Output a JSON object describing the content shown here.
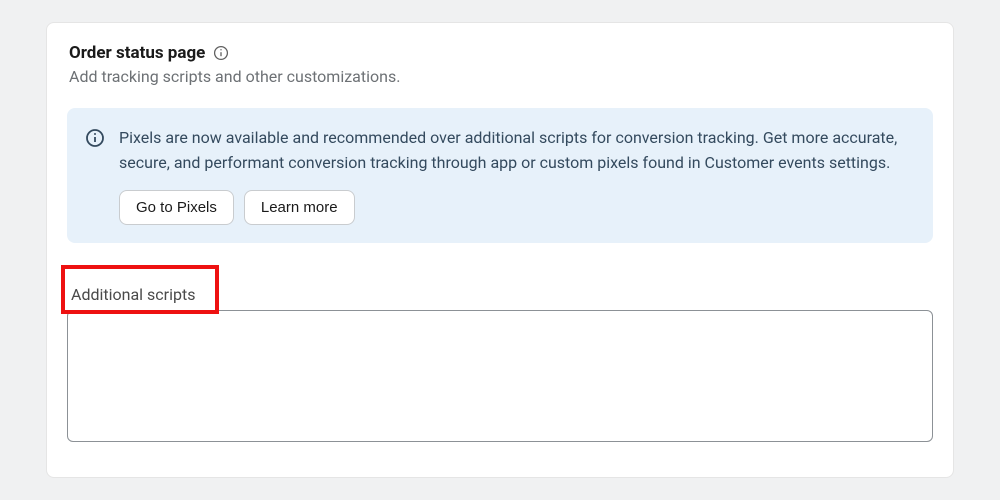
{
  "header": {
    "title": "Order status page",
    "subtitle": "Add tracking scripts and other customizations."
  },
  "banner": {
    "message": "Pixels are now available and recommended over additional scripts for conversion tracking. Get more accurate, secure, and performant conversion tracking through app or custom pixels found in Customer events settings.",
    "primary_btn": "Go to Pixels",
    "secondary_btn": "Learn more"
  },
  "field": {
    "label": "Additional scripts",
    "value": ""
  }
}
